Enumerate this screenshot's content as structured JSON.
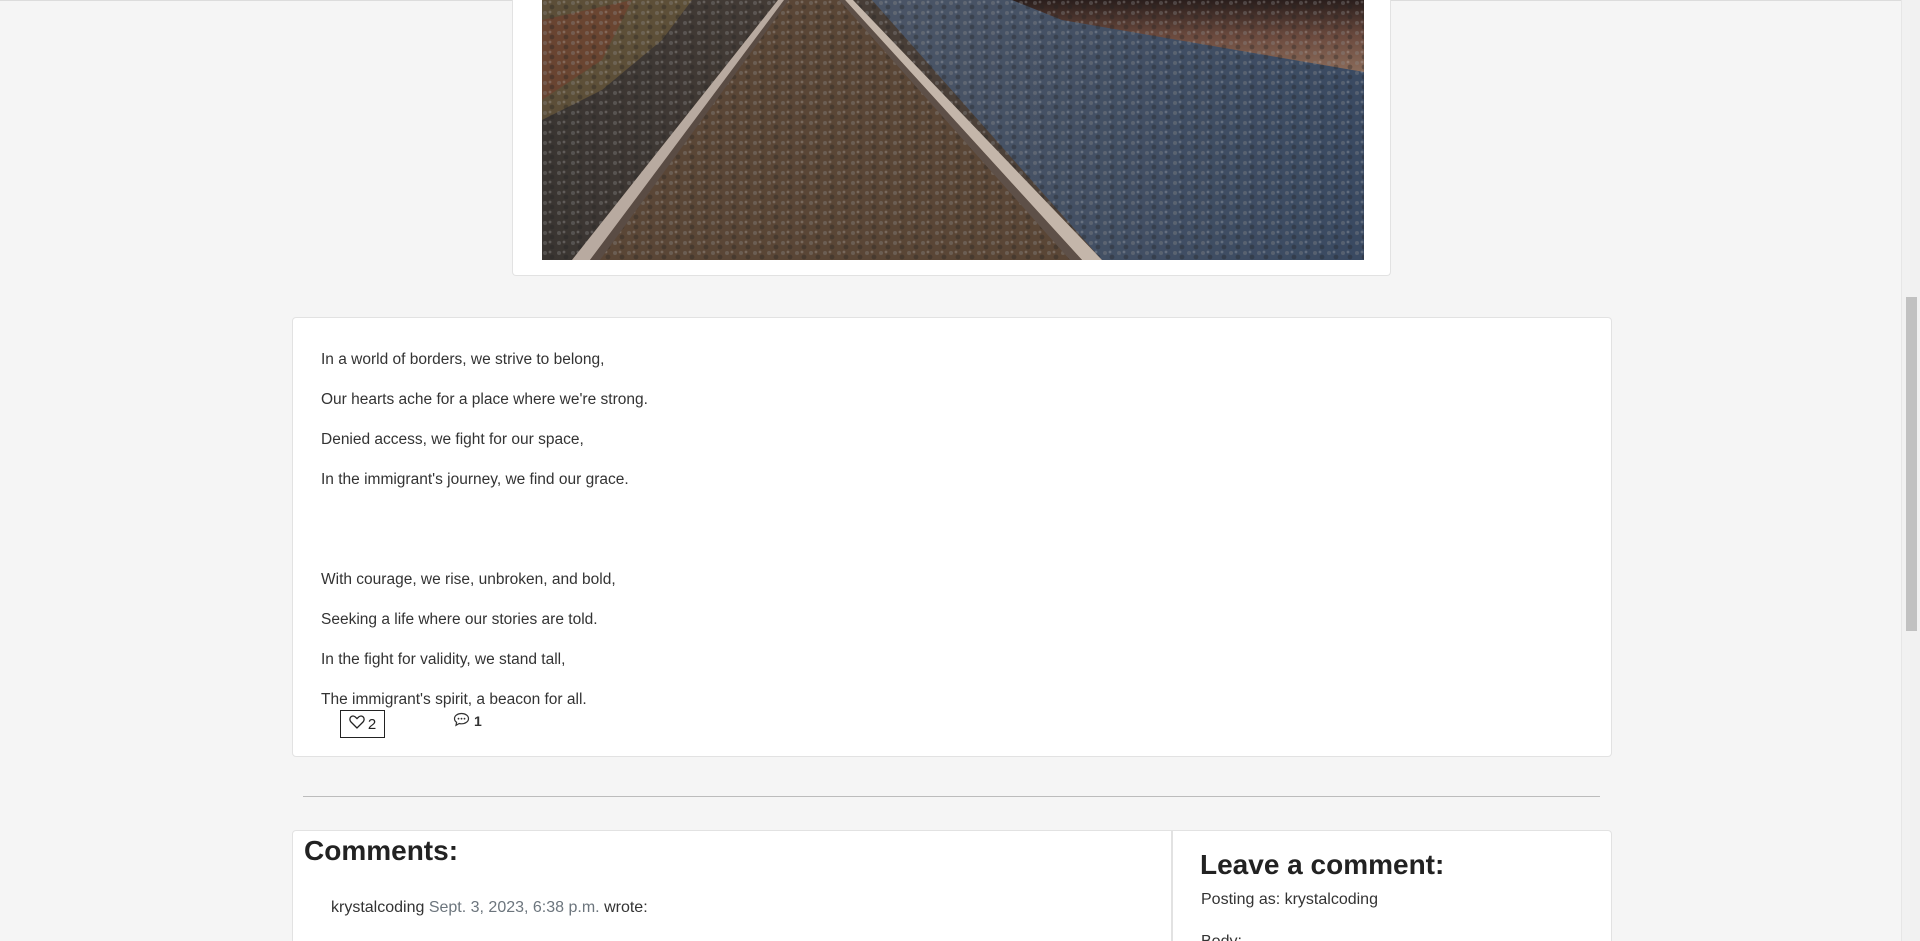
{
  "post": {
    "image_alt": "Railroad tracks",
    "poem_lines": [
      "In a world of borders, we strive to belong,",
      "Our hearts ache for a place where we're strong.",
      "Denied access, we fight for our space,",
      "In the immigrant's journey, we find our grace.",
      "With courage, we rise, unbroken, and bold,",
      "Seeking a life where our stories are told.",
      "In the fight for validity, we stand tall,",
      "The immigrant's spirit, a beacon for all."
    ],
    "like_count": "2",
    "comment_count": "1",
    "like_icon": "heart-outline-icon",
    "comment_icon": "speech-bubble-icon"
  },
  "comments": {
    "heading": "Comments:",
    "items": [
      {
        "author": "krystalcoding",
        "date": "Sept. 3, 2023, 6:38 p.m.",
        "wrote": "wrote:"
      }
    ]
  },
  "leave_comment": {
    "heading": "Leave a comment:",
    "posting_as": "Posting as: krystalcoding",
    "body_label": "Body:"
  }
}
